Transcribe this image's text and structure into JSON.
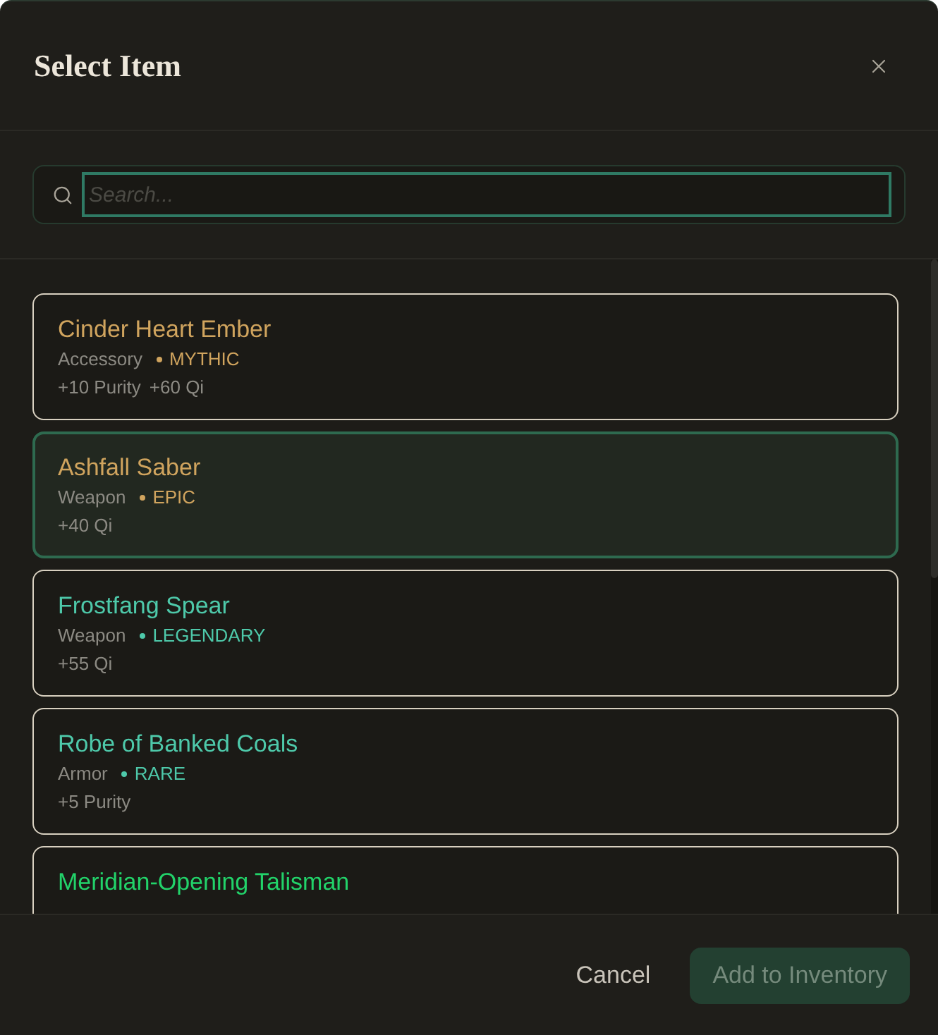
{
  "dialog": {
    "title": "Select Item"
  },
  "search": {
    "placeholder": "Search..."
  },
  "items": [
    {
      "name": "Cinder Heart Ember",
      "type": "Accessory",
      "rarity": "MYTHIC",
      "color": "#d0a45e",
      "stats": [
        "+10 Purity",
        "+60 Qi"
      ],
      "selected": false
    },
    {
      "name": "Ashfall Saber",
      "type": "Weapon",
      "rarity": "EPIC",
      "color": "#d0a45e",
      "stats": [
        "+40 Qi"
      ],
      "selected": true
    },
    {
      "name": "Frostfang Spear",
      "type": "Weapon",
      "rarity": "LEGENDARY",
      "color": "#4ec9aa",
      "stats": [
        "+55 Qi"
      ],
      "selected": false
    },
    {
      "name": "Robe of Banked Coals",
      "type": "Armor",
      "rarity": "RARE",
      "color": "#4ec9aa",
      "stats": [
        "+5 Purity"
      ],
      "selected": false
    },
    {
      "name": "Meridian-Opening Talisman",
      "color": "#22d36a",
      "selected": false
    }
  ],
  "footer": {
    "buttons": [
      {
        "label": "Cancel",
        "kind": "secondary"
      },
      {
        "label": "Add to Inventory",
        "kind": "primary"
      }
    ]
  }
}
